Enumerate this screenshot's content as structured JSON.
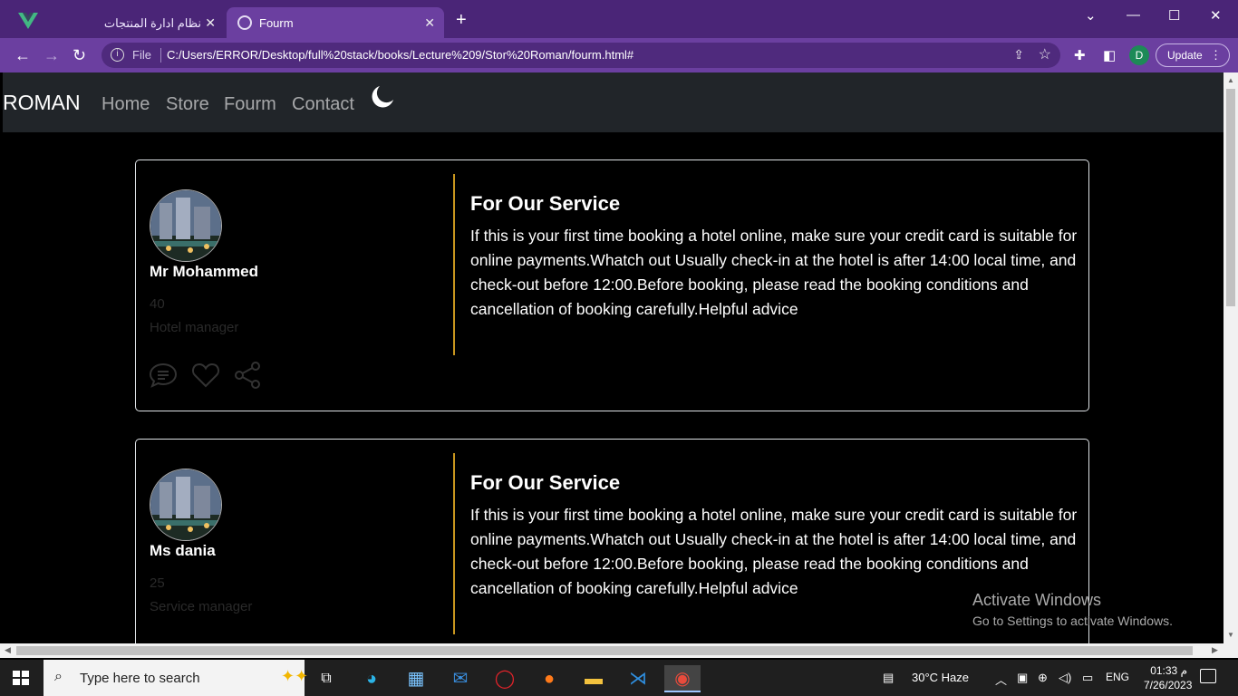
{
  "browser": {
    "tabs": [
      {
        "title": "نظام ادارة المنتجات",
        "active": false
      },
      {
        "title": "Fourm",
        "active": true
      }
    ],
    "omnibox": {
      "prefix": "File",
      "url": "C:/Users/ERROR/Desktop/full%20stack/books/Lecture%209/Stor%20Roman/fourm.html#"
    },
    "profile_initial": "D",
    "update_label": "Update"
  },
  "site": {
    "brand": "ROMAN",
    "nav": [
      "Home",
      "Store",
      "Fourm",
      "Contact"
    ],
    "theme_icon": "moon-icon"
  },
  "posts": [
    {
      "name": "Mr Mohammed",
      "age": "40",
      "role": "Hotel manager",
      "title": "For Our Service",
      "body": "If this is your first time booking a hotel online, make sure your credit card is suitable for online payments.Whatch out Usually check-in at the hotel is after 14:00 local time, and check-out before 12:00.Before booking, please read the booking conditions and cancellation of booking carefully.Helpful advice"
    },
    {
      "name": "Ms dania",
      "age": "25",
      "role": "Service manager",
      "title": "For Our Service",
      "body": "If this is your first time booking a hotel online, make sure your credit card is suitable for online payments.Whatch out Usually check-in at the hotel is after 14:00 local time, and check-out before 12:00.Before booking, please read the booking conditions and cancellation of booking carefully.Helpful advice"
    }
  ],
  "watermark": {
    "line1": "Activate Windows",
    "line2": "Go to Settings to activate Windows."
  },
  "taskbar": {
    "search_placeholder": "Type here to search",
    "weather": "30°C  Haze",
    "lang": "ENG",
    "time": "01:33 م",
    "date": "7/26/2023"
  },
  "colors": {
    "chrome_dark": "#4a2577",
    "chrome": "#6b3fa0",
    "navbar": "#212529",
    "divider": "#c8961e"
  }
}
